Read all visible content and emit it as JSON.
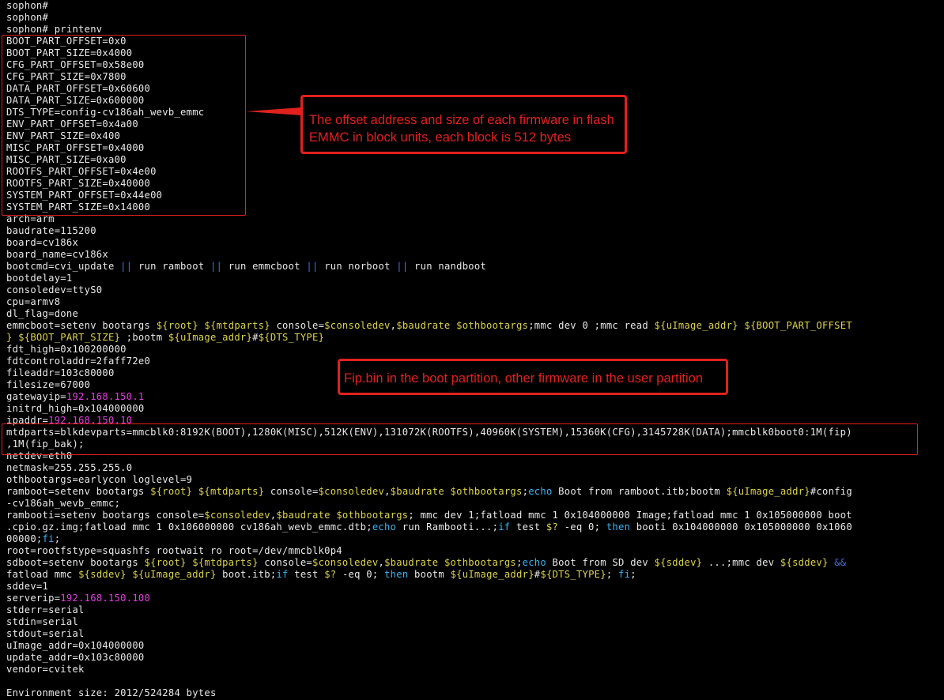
{
  "terminal": {
    "lines": [
      [
        [
          "sophon#",
          ""
        ]
      ],
      [
        [
          "sophon#",
          ""
        ]
      ],
      [
        [
          "sophon# printenv",
          ""
        ]
      ],
      [
        [
          "BOOT_PART_OFFSET=0x0",
          ""
        ]
      ],
      [
        [
          "BOOT_PART_SIZE=0x4000",
          ""
        ]
      ],
      [
        [
          "CFG_PART_OFFSET=0x58e00",
          ""
        ]
      ],
      [
        [
          "CFG_PART_SIZE=0x7800",
          ""
        ]
      ],
      [
        [
          "DATA_PART_OFFSET=0x60600",
          ""
        ]
      ],
      [
        [
          "DATA_PART_SIZE=0x600000",
          ""
        ]
      ],
      [
        [
          "DTS_TYPE=config-cv186ah_wevb_emmc",
          ""
        ]
      ],
      [
        [
          "ENV_PART_OFFSET=0x4a00",
          ""
        ]
      ],
      [
        [
          "ENV_PART_SIZE=0x400",
          ""
        ]
      ],
      [
        [
          "MISC_PART_OFFSET=0x4000",
          ""
        ]
      ],
      [
        [
          "MISC_PART_SIZE=0xa00",
          ""
        ]
      ],
      [
        [
          "ROOTFS_PART_OFFSET=0x4e00",
          ""
        ]
      ],
      [
        [
          "ROOTFS_PART_SIZE=0x40000",
          ""
        ]
      ],
      [
        [
          "SYSTEM_PART_OFFSET=0x44e00",
          ""
        ]
      ],
      [
        [
          "SYSTEM_PART_SIZE=0x14000",
          ""
        ]
      ],
      [
        [
          "arch=arm",
          ""
        ]
      ],
      [
        [
          "baudrate=115200",
          ""
        ]
      ],
      [
        [
          "board=cv186x",
          ""
        ]
      ],
      [
        [
          "board_name=cv186x",
          ""
        ]
      ],
      [
        [
          "bootcmd=cvi_update ",
          ""
        ],
        [
          "||",
          "b"
        ],
        [
          " run ramboot ",
          ""
        ],
        [
          "||",
          "b"
        ],
        [
          " run emmcboot ",
          ""
        ],
        [
          "||",
          "b"
        ],
        [
          " run norboot ",
          ""
        ],
        [
          "||",
          "b"
        ],
        [
          " run nandboot",
          ""
        ]
      ],
      [
        [
          "bootdelay=1",
          ""
        ]
      ],
      [
        [
          "consoledev=ttyS0",
          ""
        ]
      ],
      [
        [
          "cpu=armv8",
          ""
        ]
      ],
      [
        [
          "dl_flag=done",
          ""
        ]
      ],
      [
        [
          "emmcboot=setenv bootargs ",
          ""
        ],
        [
          "${root}",
          "y"
        ],
        [
          " ",
          ""
        ],
        [
          "${mtdparts}",
          "y"
        ],
        [
          " console=",
          ""
        ],
        [
          "$consoledev",
          "y"
        ],
        [
          ",",
          ""
        ],
        [
          "$baudrate",
          "y"
        ],
        [
          " ",
          ""
        ],
        [
          "$othbootargs",
          "y"
        ],
        [
          ";mmc dev 0 ;mmc read ",
          ""
        ],
        [
          "${uImage_addr}",
          "y"
        ],
        [
          " ",
          ""
        ],
        [
          "${BOOT_PART_OFFSET",
          "y"
        ]
      ],
      [
        [
          "} ${BOOT_PART_SIZE}",
          "y"
        ],
        [
          " ;bootm ",
          ""
        ],
        [
          "${uImage_addr}",
          "y"
        ],
        [
          "#",
          ""
        ],
        [
          "${DTS_TYPE}",
          "y"
        ]
      ],
      [
        [
          "fdt_high=0x100200000",
          ""
        ]
      ],
      [
        [
          "fdtcontroladdr=2faff72e0",
          ""
        ]
      ],
      [
        [
          "fileaddr=103c80000",
          ""
        ]
      ],
      [
        [
          "filesize=67000",
          ""
        ]
      ],
      [
        [
          "gatewayip=",
          ""
        ],
        [
          "192.168.150.1",
          "m"
        ]
      ],
      [
        [
          "initrd_high=0x104000000",
          ""
        ]
      ],
      [
        [
          "ipaddr=",
          ""
        ],
        [
          "192.168.150.10",
          "m"
        ]
      ],
      [
        [
          "mtdparts=blkdevparts=mmcblk0:8192K(BOOT),1280K(MISC),512K(ENV),131072K(ROOTFS),40960K(SYSTEM),15360K(CFG),3145728K(DATA);mmcblk0boot0:1M(fip)",
          ""
        ]
      ],
      [
        [
          ",1M(fip_bak);",
          ""
        ]
      ],
      [
        [
          "netdev=eth0",
          ""
        ]
      ],
      [
        [
          "netmask=255.255.255.0",
          ""
        ]
      ],
      [
        [
          "othbootargs=earlycon loglevel=9",
          ""
        ]
      ],
      [
        [
          "ramboot=setenv bootargs ",
          ""
        ],
        [
          "${root}",
          "y"
        ],
        [
          " ",
          ""
        ],
        [
          "${mtdparts}",
          "y"
        ],
        [
          " console=",
          ""
        ],
        [
          "$consoledev",
          "y"
        ],
        [
          ",",
          ""
        ],
        [
          "$baudrate",
          "y"
        ],
        [
          " ",
          ""
        ],
        [
          "$othbootargs",
          "y"
        ],
        [
          ";",
          ""
        ],
        [
          "echo",
          "c"
        ],
        [
          " Boot from ramboot.itb;bootm ",
          ""
        ],
        [
          "${uImage_addr}",
          "y"
        ],
        [
          "#config",
          ""
        ]
      ],
      [
        [
          "-cv186ah_wevb_emmc;",
          ""
        ]
      ],
      [
        [
          "rambooti=setenv bootargs console=",
          ""
        ],
        [
          "$consoledev",
          "y"
        ],
        [
          ",",
          ""
        ],
        [
          "$baudrate",
          "y"
        ],
        [
          " ",
          ""
        ],
        [
          "$othbootargs",
          "y"
        ],
        [
          "; mmc dev 1;fatload mmc 1 0x104000000 Image;fatload mmc 1 0x105000000 boot",
          ""
        ]
      ],
      [
        [
          ".cpio.gz.img;fatload mmc 1 0x106000000 cv186ah_wevb_emmc.dtb;",
          ""
        ],
        [
          "echo",
          "c"
        ],
        [
          " run Rambooti...;",
          ""
        ],
        [
          "if",
          "c"
        ],
        [
          " test ",
          ""
        ],
        [
          "$?",
          "y"
        ],
        [
          " -eq 0; ",
          ""
        ],
        [
          "then",
          "c"
        ],
        [
          " booti 0x104000000 0x105000000 0x1060",
          ""
        ]
      ],
      [
        [
          "00000;",
          ""
        ],
        [
          "fi",
          "c"
        ],
        [
          ";",
          ""
        ]
      ],
      [
        [
          "root=rootfstype=squashfs rootwait ro root=/dev/mmcblk0p4",
          ""
        ]
      ],
      [
        [
          "sdboot=setenv bootargs ",
          ""
        ],
        [
          "${root}",
          "y"
        ],
        [
          " ",
          ""
        ],
        [
          "${mtdparts}",
          "y"
        ],
        [
          " console=",
          ""
        ],
        [
          "$consoledev",
          "y"
        ],
        [
          ",",
          ""
        ],
        [
          "$baudrate",
          "y"
        ],
        [
          " ",
          ""
        ],
        [
          "$othbootargs",
          "y"
        ],
        [
          ";",
          ""
        ],
        [
          "echo",
          "c"
        ],
        [
          " Boot from SD dev ",
          ""
        ],
        [
          "${sddev}",
          "y"
        ],
        [
          " ...;mmc dev ",
          ""
        ],
        [
          "${sddev}",
          "y"
        ],
        [
          " ",
          ""
        ],
        [
          "&&",
          "b"
        ]
      ],
      [
        [
          "fatload mmc ",
          ""
        ],
        [
          "${sddev}",
          "y"
        ],
        [
          " ",
          ""
        ],
        [
          "${uImage_addr}",
          "y"
        ],
        [
          " boot.itb;",
          ""
        ],
        [
          "if",
          "c"
        ],
        [
          " test ",
          ""
        ],
        [
          "$?",
          "y"
        ],
        [
          " -eq 0; ",
          ""
        ],
        [
          "then",
          "c"
        ],
        [
          " bootm ",
          ""
        ],
        [
          "${uImage_addr}",
          "y"
        ],
        [
          "#",
          ""
        ],
        [
          "${DTS_TYPE}",
          "y"
        ],
        [
          "; ",
          ""
        ],
        [
          "fi",
          "c"
        ],
        [
          ";",
          ""
        ]
      ],
      [
        [
          "sddev=1",
          ""
        ]
      ],
      [
        [
          "serverip=",
          ""
        ],
        [
          "192.168.150.100",
          "m"
        ]
      ],
      [
        [
          "stderr=serial",
          ""
        ]
      ],
      [
        [
          "stdin=serial",
          ""
        ]
      ],
      [
        [
          "stdout=serial",
          ""
        ]
      ],
      [
        [
          "uImage_addr=0x104000000",
          ""
        ]
      ],
      [
        [
          "update_addr=0x103c80000",
          ""
        ]
      ],
      [
        [
          "vendor=cvitek",
          ""
        ]
      ],
      [
        [
          "",
          ""
        ]
      ],
      [
        [
          "Environment size: 2012/524284 bytes",
          ""
        ]
      ]
    ]
  },
  "annotations": {
    "callout1_line1": "The offset address and size of each firmware in flash",
    "callout1_line2": "EMMC in block units, each block is 512 bytes",
    "callout2_text": "Fip.bin in the boot partition, other firmware in the user partition"
  },
  "colors": {
    "background": "#000000",
    "text": "#e8e8e8",
    "variable": "#dcd34a",
    "keyword": "#38b4f0",
    "ip": "#e23fe0",
    "operator": "#4a6fd8",
    "annotation": "#e0211d"
  }
}
